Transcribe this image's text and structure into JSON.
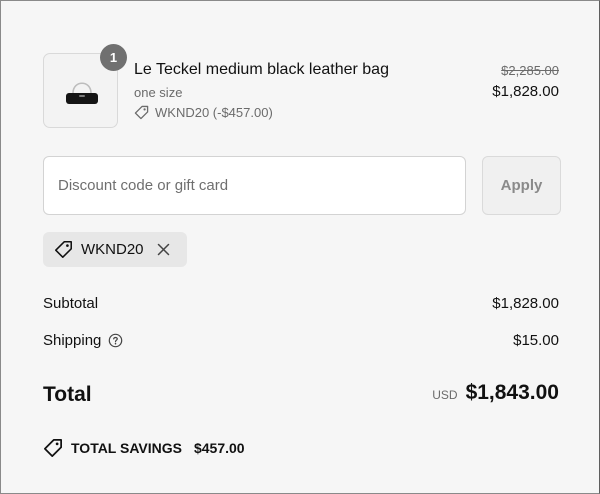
{
  "product": {
    "quantity": "1",
    "name": "Le Teckel medium black leather bag",
    "variant": "one size",
    "discount_label": "WKND20 (-$457.00)",
    "price_original": "$2,285.00",
    "price_current": "$1,828.00"
  },
  "discount_form": {
    "placeholder": "Discount code or gift card",
    "value": "",
    "apply_label": "Apply"
  },
  "applied_code": {
    "label": "WKND20"
  },
  "summary": {
    "subtotal_label": "Subtotal",
    "subtotal_value": "$1,828.00",
    "shipping_label": "Shipping",
    "shipping_value": "$15.00",
    "total_label": "Total",
    "total_currency": "USD",
    "total_value": "$1,843.00"
  },
  "savings": {
    "label": "TOTAL SAVINGS",
    "amount": "$457.00"
  },
  "icons": {
    "tag": "tag-icon",
    "close": "close-icon",
    "help": "help-circle-icon",
    "bag": "bag-image"
  },
  "colors": {
    "background": "#f6f6f6",
    "badge": "#707070",
    "muted_text": "#6b6b6b",
    "chip": "#e7e7e7"
  }
}
